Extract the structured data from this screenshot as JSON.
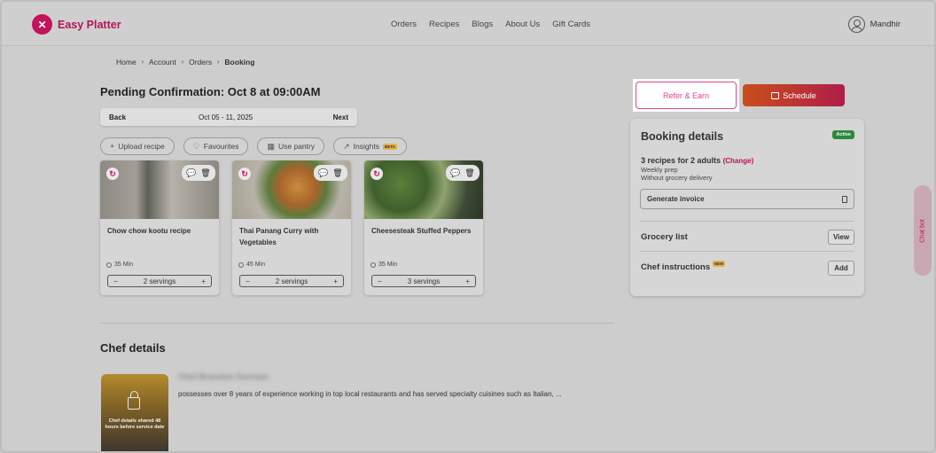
{
  "brand": {
    "name": "Easy Platter",
    "accent": "#c4125b"
  },
  "nav": [
    "Orders",
    "Recipes",
    "Blogs",
    "About Us",
    "Gift Cards"
  ],
  "user": {
    "name": "Mandhir"
  },
  "breadcrumb": [
    "Home",
    "Account",
    "Orders",
    "Booking"
  ],
  "page": {
    "title": "Pending Confirmation: Oct 8 at 09:00AM"
  },
  "week": {
    "back": "Back",
    "range": "Oct 05 - 11, 2025",
    "next": "Next"
  },
  "filters": {
    "upload": "Upload recipe",
    "favourites": "Favourites",
    "pantry": "Use pantry",
    "insights": "Insights",
    "beta": "BETA"
  },
  "recipes": [
    {
      "title": "Chow chow kootu recipe",
      "time": "35 Min",
      "servings": "2 servings"
    },
    {
      "title": "Thai Panang Curry with Vegetables",
      "time": "45 Min",
      "servings": "2 servings"
    },
    {
      "title": "Cheesesteak Stuffed Peppers",
      "time": "35 Min",
      "servings": "3 servings"
    }
  ],
  "chef": {
    "heading": "Chef details",
    "name": "Chef Brandon Gorman",
    "bio": "possesses over 8 years of experience working in top local restaurants and has served specialty cuisines such as Italian, ...",
    "photo_note": "Chef details shared 48 hours before service date"
  },
  "actions": {
    "refer": "Refer & Earn",
    "schedule": "Schedule"
  },
  "booking": {
    "title": "Booking details",
    "status": "Active",
    "recipes_line": "3 recipes for 2 adults",
    "change": "(Change)",
    "plan": "Weekly prep",
    "delivery": "Without grocery delivery",
    "invoice": "Generate invoice",
    "grocery_label": "Grocery list",
    "grocery_btn": "View",
    "instructions_label": "Chef instructions",
    "new_badge": "NEW",
    "instructions_btn": "Add"
  },
  "chatbot": {
    "label": "Chat bot"
  }
}
